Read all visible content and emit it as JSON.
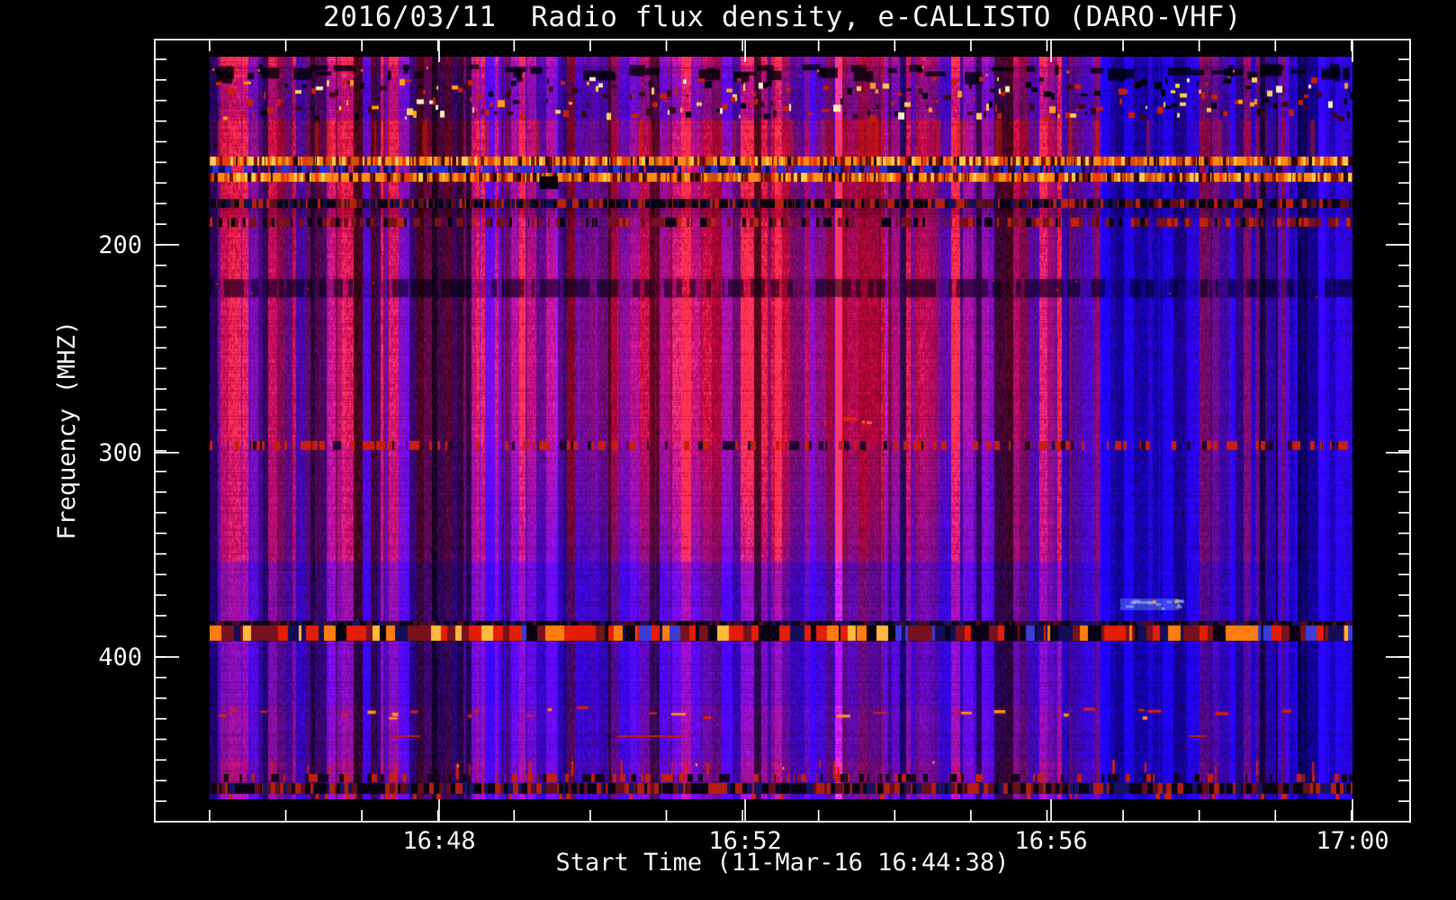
{
  "page": {
    "background": "#000000",
    "text_color": "#F5F5F5",
    "frame_color": "#FFFFFF"
  },
  "chart_data": {
    "type": "heatmap",
    "title": "2016/03/11  Radio flux density, e-CALLISTO (DARO-VHF)",
    "xlabel": "Start Time (11-Mar-16 16:44:38)",
    "ylabel": "Frequency (MHZ)",
    "legend": "none",
    "grid": "off",
    "x_axis": {
      "ticks": [
        {
          "label": "16:48",
          "frac": 0.2265
        },
        {
          "label": "16:52",
          "frac": 0.4703
        },
        {
          "label": "16:56",
          "frac": 0.714
        },
        {
          "label": "17:00",
          "frac": 0.9541
        }
      ],
      "minor": {
        "start_frac": 0.0437,
        "step_frac": 0.06064,
        "count": 16
      },
      "start_time": "16:44:38",
      "end_time": "17:00"
    },
    "y_axis": {
      "ticks": [
        {
          "label": "200",
          "frac": 0.2624
        },
        {
          "label": "300",
          "frac": 0.5282
        },
        {
          "label": "400",
          "frac": 0.7894
        }
      ],
      "minor": {
        "start_frac": 0.0252,
        "step_frac": 0.02635,
        "count": 37
      },
      "range_mhz": [
        101,
        477
      ],
      "direction": "increasing-downward"
    },
    "data_extent": {
      "x_frac": [
        0.0437,
        0.9541
      ],
      "y_frac": [
        0.0219,
        0.9712
      ],
      "freq_mhz": [
        108.8,
        469.0
      ]
    },
    "palette": {
      "background": "#000000",
      "deep_blue": "#0000C8",
      "bright_blue": "#2A2AFF",
      "purple": "#6B0D8A",
      "red_purple": "#8B1266",
      "red": "#C81E00",
      "dark_red": "#78101E",
      "orange": "#FF8C14",
      "yellow": "#FFD24B",
      "white_speck": "#FFF0C0",
      "dark_navy": "#000050"
    },
    "bands": [
      {
        "kind": "striped-top",
        "freq_mhz": [
          108.8,
          112.3
        ]
      },
      {
        "kind": "mottled-dark",
        "freq_mhz": [
          112.3,
          118.4
        ]
      },
      {
        "kind": "speckle",
        "freq_mhz": [
          118.4,
          128.2
        ]
      },
      {
        "kind": "speckle",
        "freq_mhz": [
          128.2,
          139.1
        ]
      },
      {
        "kind": "red-stripes",
        "freq_mhz": [
          139.1,
          157.2
        ]
      },
      {
        "kind": "rfi-orange",
        "freq_mhz": [
          157.2,
          161.5
        ]
      },
      {
        "kind": "blue-dashes",
        "freq_mhz": [
          161.5,
          165.0
        ]
      },
      {
        "kind": "rfi-orange",
        "freq_mhz": [
          165.0,
          169.4
        ]
      },
      {
        "kind": "dark-dashes",
        "freq_mhz": [
          177.9,
          182.2
        ]
      },
      {
        "kind": "weak-red-dashes",
        "freq_mhz": [
          187.0,
          191.4
        ]
      },
      {
        "kind": "wide-dark-dashes",
        "freq_mhz": [
          216.6,
          225.3
        ]
      },
      {
        "kind": "center-red-streak",
        "freq_mhz": [
          283.3,
          287.7
        ],
        "x_frac": [
          0.538,
          0.579
        ]
      },
      {
        "kind": "red-dash-row",
        "freq_mhz": [
          295.2,
          299.6
        ]
      },
      {
        "kind": "rfi-strong",
        "freq_mhz": [
          382.6,
          392.2
        ]
      },
      {
        "kind": "sparse-red-dashes",
        "freq_mhz": [
          423.5,
          430.5
        ]
      },
      {
        "kind": "red-streaks",
        "freq_mhz": [
          449.9,
          460.8
        ]
      },
      {
        "kind": "dense-dark",
        "freq_mhz": [
          461.2,
          466.4
        ]
      },
      {
        "kind": "bottom-stripes",
        "freq_mhz": [
          466.4,
          469.0
        ]
      }
    ],
    "events": [
      {
        "kind": "center-haze",
        "cx_frac": 0.457,
        "cy_freq_mhz": 253,
        "rx_frac": 0.268,
        "ry_mhz": 114
      },
      {
        "kind": "quiet-section",
        "from_x_frac": 0.75,
        "brightness": 0.82,
        "red_suppress": 0.15
      },
      {
        "kind": "red-columns",
        "ranges_x_frac": [
          [
            0.722,
            0.78
          ],
          [
            0.866,
            0.911
          ],
          [
            0.915,
            0.945
          ]
        ],
        "strength": [
          0.85,
          0.7,
          0.75
        ]
      },
      {
        "kind": "blue-smear",
        "x_frac": [
          0.797,
          0.848
        ],
        "freq_mhz": [
          371.7,
          377.4
        ]
      },
      {
        "kind": "thin-red-lines",
        "freq_mhz": 437.8,
        "segments_x_frac": [
          [
            0.16,
            0.184
          ],
          [
            0.357,
            0.413
          ],
          [
            0.857,
            0.872
          ]
        ]
      },
      {
        "kind": "black-blob",
        "x_frac": [
          0.289,
          0.305
        ],
        "freq_mhz": [
          166.8,
          173.0
        ]
      },
      {
        "kind": "bright-blue-lines",
        "x_frac": [
          0.895,
          0.9425,
          0.9858
        ]
      },
      {
        "kind": "dark-columns",
        "ranges_x_frac": [
          [
            0.088,
            0.102
          ],
          [
            0.175,
            0.222
          ],
          [
            0.305,
            0.32
          ],
          [
            0.687,
            0.703
          ]
        ]
      }
    ]
  }
}
